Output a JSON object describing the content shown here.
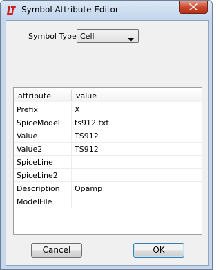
{
  "window": {
    "title": "Symbol Attribute Editor",
    "app_icon": "ltspice-logo-icon",
    "close_icon": "close-icon"
  },
  "symbol_type": {
    "label": "Symbol Type:",
    "selected": "Cell",
    "dropdown_icon": "chevron-down-icon"
  },
  "table": {
    "columns": [
      "attribute",
      "value"
    ],
    "rows": [
      {
        "attribute": "Prefix",
        "value": "X"
      },
      {
        "attribute": "SpiceModel",
        "value": "ts912.txt"
      },
      {
        "attribute": "Value",
        "value": "TS912"
      },
      {
        "attribute": "Value2",
        "value": "TS912"
      },
      {
        "attribute": "SpiceLine",
        "value": ""
      },
      {
        "attribute": "SpiceLine2",
        "value": ""
      },
      {
        "attribute": "Description",
        "value": "Opamp"
      },
      {
        "attribute": "ModelFile",
        "value": ""
      }
    ]
  },
  "buttons": {
    "cancel": "Cancel",
    "ok": "OK"
  },
  "colors": {
    "frame": "#c4d7ec",
    "close_button": "#c7432b",
    "client_bg": "#f0f0f0",
    "logo_red": "#cc1f1f"
  }
}
